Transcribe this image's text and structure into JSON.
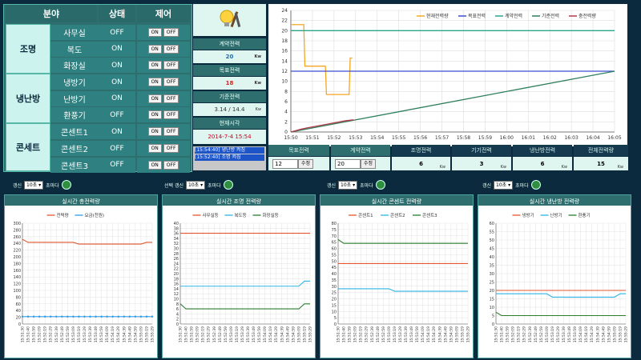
{
  "control": {
    "headers": [
      "분야",
      "상태",
      "제어"
    ],
    "on_label": "ON",
    "off_label": "OFF",
    "groups": [
      {
        "name": "조명",
        "rows": [
          {
            "name": "사무실",
            "state": "OFF"
          },
          {
            "name": "복도",
            "state": "ON"
          },
          {
            "name": "화장실",
            "state": "ON"
          }
        ]
      },
      {
        "name": "냉난방",
        "rows": [
          {
            "name": "냉방기",
            "state": "ON"
          },
          {
            "name": "난방기",
            "state": "ON"
          },
          {
            "name": "환풍기",
            "state": "OFF"
          }
        ]
      },
      {
        "name": "콘세트",
        "rows": [
          {
            "name": "콘센트1",
            "state": "ON"
          },
          {
            "name": "콘센트2",
            "state": "OFF"
          },
          {
            "name": "콘센트3",
            "state": "OFF"
          }
        ]
      }
    ]
  },
  "info": {
    "contract_label": "계약전력",
    "contract_value": "20",
    "contract_unit": "Kw",
    "target_label": "목표전력",
    "target_value": "18",
    "target_unit": "Kw",
    "standard_label": "기준전력",
    "standard_value": "3.14 / 14.4",
    "standard_unit": "Kw",
    "time_label": "현재시각",
    "time_value": "2014-7-4 15:54"
  },
  "logs": [
    "[15:54:40] 냉난방 켜짐",
    "[15:52:40] 조명 켜짐"
  ],
  "bottom": {
    "target_tab": "목표전력",
    "contract_tab": "계약전력",
    "target_input": "12",
    "contract_input": "20",
    "set_label": "수정",
    "tabs": [
      {
        "label": "조명전력",
        "value": "6",
        "unit": "Kw"
      },
      {
        "label": "기기전력",
        "value": "3",
        "unit": "Kw"
      },
      {
        "label": "냉난방전력",
        "value": "6",
        "unit": "Kw"
      },
      {
        "label": "전체전력량",
        "value": "15",
        "unit": "Kw"
      }
    ]
  },
  "refresh": [
    {
      "prefix": "갱신",
      "sel": "10초",
      "suffix": "초마다"
    },
    {
      "prefix": "선택 갱신",
      "sel": "10초",
      "suffix": "초마다"
    },
    {
      "prefix": "갱신",
      "sel": "10초",
      "suffix": "초마다"
    },
    {
      "prefix": "갱신",
      "sel": "10초",
      "suffix": "초마다"
    }
  ],
  "colors": {
    "orange": "#f5a623",
    "blue": "#3b4fd0",
    "teal": "#2aa58a",
    "green": "#2e7d5b",
    "red": "#b23a48"
  },
  "chart_data": [
    {
      "type": "line",
      "title": "",
      "x": [
        "15:50",
        "15:51",
        "15:52",
        "15:53",
        "15:54",
        "15:55",
        "15:56",
        "15:57",
        "15:58",
        "15:59",
        "16:00",
        "16:01",
        "16:02",
        "16:03",
        "16:04",
        "16:05"
      ],
      "ylim": [
        0,
        24
      ],
      "yticks": [
        0,
        2,
        4,
        6,
        8,
        10,
        12,
        14,
        16,
        18,
        20,
        22,
        24
      ],
      "series": [
        {
          "name": "현재전력량",
          "color": "#f5a623",
          "points": [
            [
              0,
              21.2
            ],
            [
              0.6,
              21.2
            ],
            [
              0.65,
              13
            ],
            [
              0.95,
              13
            ],
            [
              1.0,
              13
            ],
            [
              1.6,
              13
            ],
            [
              1.65,
              7.4
            ],
            [
              2.0,
              7.4
            ],
            [
              2.7,
              7.4
            ],
            [
              2.75,
              14.6
            ],
            [
              2.85,
              14.6
            ]
          ]
        },
        {
          "name": "목표전력",
          "color": "#3b4fd0",
          "points": [
            [
              0,
              12
            ],
            [
              15,
              12
            ]
          ]
        },
        {
          "name": "계약전력",
          "color": "#2aa58a",
          "points": [
            [
              0,
              20
            ],
            [
              15,
              20
            ]
          ]
        },
        {
          "name": "기준전력",
          "color": "#2e7d5b",
          "points": [
            [
              0,
              0
            ],
            [
              15,
              12
            ]
          ]
        },
        {
          "name": "충전력량",
          "color": "#b23a48",
          "points": [
            [
              0,
              0
            ],
            [
              0.5,
              0.6
            ],
            [
              1,
              1
            ],
            [
              1.5,
              1.4
            ],
            [
              2,
              1.8
            ],
            [
              2.5,
              2.2
            ],
            [
              2.9,
              2.4
            ]
          ]
        }
      ]
    },
    {
      "type": "line",
      "title": "실시간 총전력량",
      "ylim": [
        0,
        300
      ],
      "yticks": [
        0,
        20,
        40,
        60,
        80,
        100,
        120,
        140,
        160,
        180,
        200,
        220,
        240,
        260,
        280,
        300
      ],
      "xcount": 24,
      "xlabel_tick": "15:53:19",
      "series": [
        {
          "name": "전력량",
          "color": "#e4572e",
          "values": [
            252,
            243,
            243,
            243,
            243,
            243,
            243,
            243,
            243,
            243,
            238,
            238,
            238,
            238,
            238,
            238,
            238,
            238,
            238,
            238,
            238,
            238,
            243,
            243
          ]
        },
        {
          "name": "요금(천원)",
          "color": "#2e9be5",
          "values": [
            22,
            22,
            22,
            22,
            22,
            22,
            22,
            22,
            22,
            22,
            22,
            22,
            22,
            22,
            22,
            22,
            22,
            22,
            22,
            22,
            22,
            22,
            22,
            22
          ],
          "markers": true
        }
      ]
    },
    {
      "type": "line",
      "title": "실시간 조명 전력량",
      "ylim": [
        0,
        40
      ],
      "yticks": [
        0,
        2,
        4,
        6,
        8,
        10,
        12,
        14,
        16,
        18,
        20,
        22,
        24,
        26,
        28,
        30,
        32,
        34,
        36,
        38,
        40
      ],
      "xcount": 24,
      "series": [
        {
          "name": "사무실등",
          "color": "#e4572e",
          "values": [
            36,
            36,
            36,
            36,
            36,
            36,
            36,
            36,
            36,
            36,
            36,
            36,
            36,
            36,
            36,
            36,
            36,
            36,
            36,
            36,
            36,
            36,
            36,
            36
          ]
        },
        {
          "name": "복도등",
          "color": "#2eb5e5",
          "values": [
            15,
            15,
            15,
            15,
            15,
            15,
            15,
            15,
            15,
            15,
            15,
            15,
            15,
            15,
            15,
            15,
            15,
            15,
            15,
            15,
            15,
            15,
            17,
            17
          ]
        },
        {
          "name": "화장실등",
          "color": "#2a7d2e",
          "values": [
            8,
            6,
            6,
            6,
            6,
            6,
            6,
            6,
            6,
            6,
            6,
            6,
            6,
            6,
            6,
            6,
            6,
            6,
            6,
            6,
            6,
            6,
            8,
            8
          ]
        }
      ]
    },
    {
      "type": "line",
      "title": "실시간 콘센트 전력량",
      "ylim": [
        0,
        80
      ],
      "yticks": [
        0,
        5,
        10,
        15,
        20,
        25,
        30,
        35,
        40,
        45,
        50,
        55,
        60,
        65,
        70,
        75,
        80
      ],
      "xcount": 24,
      "series": [
        {
          "name": "콘센트1",
          "color": "#e4572e",
          "values": [
            48,
            48,
            48,
            48,
            48,
            48,
            48,
            48,
            48,
            48,
            48,
            48,
            48,
            48,
            48,
            48,
            48,
            48,
            48,
            48,
            48,
            48,
            48,
            48
          ]
        },
        {
          "name": "콘센트2",
          "color": "#2eb5e5",
          "values": [
            28,
            28,
            28,
            28,
            28,
            28,
            28,
            28,
            28,
            28,
            26,
            26,
            26,
            26,
            26,
            26,
            26,
            26,
            26,
            26,
            26,
            26,
            26,
            26
          ]
        },
        {
          "name": "콘센트3",
          "color": "#2a7d2e",
          "values": [
            67,
            64,
            64,
            64,
            64,
            64,
            64,
            64,
            64,
            64,
            64,
            64,
            64,
            64,
            64,
            64,
            64,
            64,
            64,
            64,
            64,
            64,
            64,
            64
          ]
        }
      ]
    },
    {
      "type": "line",
      "title": "실시간 냉난방 전력량",
      "ylim": [
        0,
        60
      ],
      "yticks": [
        0,
        5,
        10,
        15,
        20,
        25,
        30,
        35,
        40,
        45,
        50,
        55,
        60
      ],
      "xcount": 24,
      "series": [
        {
          "name": "냉방기",
          "color": "#e4572e",
          "values": [
            20,
            20,
            20,
            20,
            20,
            20,
            20,
            20,
            20,
            20,
            20,
            20,
            20,
            20,
            20,
            20,
            20,
            20,
            20,
            20,
            20,
            20,
            20,
            20
          ]
        },
        {
          "name": "난방기",
          "color": "#2eb5e5",
          "values": [
            18,
            18,
            18,
            18,
            18,
            18,
            18,
            18,
            18,
            18,
            16,
            16,
            16,
            16,
            16,
            16,
            16,
            16,
            16,
            16,
            16,
            16,
            18,
            18
          ]
        },
        {
          "name": "환풍기",
          "color": "#2a7d2e",
          "values": [
            7,
            5,
            5,
            5,
            5,
            5,
            5,
            5,
            5,
            5,
            5,
            5,
            5,
            5,
            5,
            5,
            5,
            5,
            5,
            5,
            5,
            5,
            5,
            5
          ]
        }
      ]
    }
  ],
  "small_xlabels": [
    "15:51:30",
    "15:51:40",
    "15:51:59",
    "15:52:09",
    "15:52:19",
    "15:52:29",
    "15:52:39",
    "15:52:49",
    "15:52:59",
    "15:53:09",
    "15:53:19",
    "15:53:29",
    "15:53:39",
    "15:53:49",
    "15:53:59",
    "15:54:09",
    "15:54:19",
    "15:54:29",
    "15:54:39",
    "15:54:49",
    "15:54:59",
    "15:55:09",
    "15:55:19",
    "15:55:29"
  ]
}
